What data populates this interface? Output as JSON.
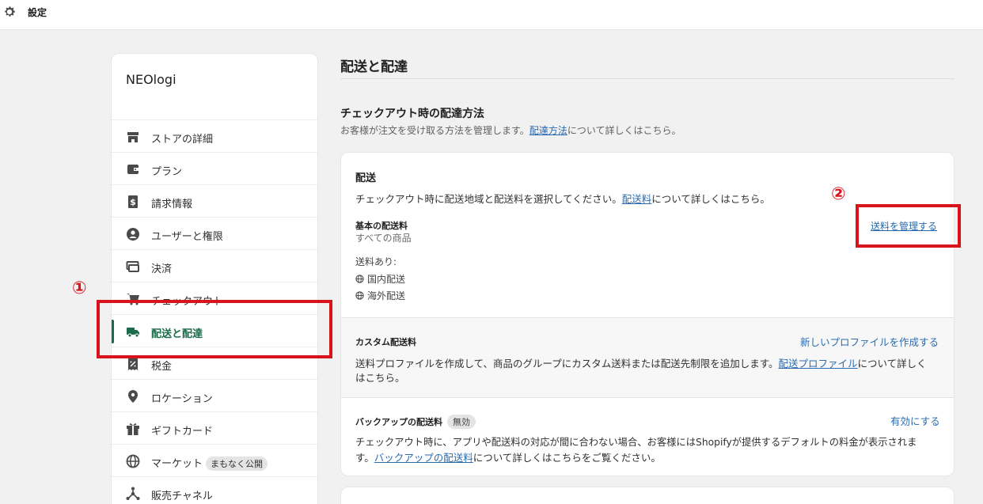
{
  "topbar": {
    "title": "設定",
    "icon": "gear-icon"
  },
  "sidebar": {
    "store_name": "NEOlogi",
    "items": [
      {
        "label": "ストアの詳細",
        "icon": "store-icon"
      },
      {
        "label": "プラン",
        "icon": "wallet-icon"
      },
      {
        "label": "請求情報",
        "icon": "dollar-icon"
      },
      {
        "label": "ユーザーと権限",
        "icon": "user-icon"
      },
      {
        "label": "決済",
        "icon": "payment-icon"
      },
      {
        "label": "チェックアウト",
        "icon": "cart-icon"
      },
      {
        "label": "配送と配達",
        "icon": "truck-icon",
        "active": true
      },
      {
        "label": "税金",
        "icon": "receipt-icon"
      },
      {
        "label": "ロケーション",
        "icon": "location-icon"
      },
      {
        "label": "ギフトカード",
        "icon": "gift-icon"
      },
      {
        "label": "マーケット",
        "icon": "globe-icon",
        "badge": "まもなく公開"
      },
      {
        "label": "販売チャネル",
        "icon": "channels-icon"
      }
    ]
  },
  "main": {
    "title": "配送と配達",
    "section_title": "チェックアウト時の配達方法",
    "section_desc_pre": "お客様が注文を受け取る方法を管理します。",
    "section_desc_link": "配達方法",
    "section_desc_post": "について詳しくはこちら。",
    "shipping": {
      "title": "配送",
      "desc_pre": "チェックアウト時に配送地域と配送料を選択してください。",
      "desc_link": "配送料",
      "desc_post": "について詳しくはこちら。",
      "base_rate_title": "基本の配送料",
      "base_rate_sub": "すべての商品",
      "manage_link": "送料を管理する",
      "rates_label": "送料あり:",
      "zones": [
        "国内配送",
        "海外配送"
      ]
    },
    "custom": {
      "title": "カスタム配送料",
      "action": "新しいプロファイルを作成する",
      "desc_pre": "送料プロファイルを作成して、商品のグループにカスタム送料または配送先制限を追加します。",
      "desc_link": "配送プロファイル",
      "desc_post": "について詳しく",
      "desc_line2": "はこちら。"
    },
    "backup": {
      "title": "バックアップの配送料",
      "badge": "無効",
      "action": "有効にする",
      "desc_line1": "チェックアウト時に、アプリや配送料の対応が間に合わない場合、お客様にはShopifyが提供するデフォルトの料金が表示されま",
      "desc_line2_pre": "す。",
      "desc_link": "バックアップの配送料",
      "desc_post": "について詳しくはこちらをご覧ください。"
    }
  },
  "annotations": {
    "marker1": "①",
    "marker2": "②",
    "color": "#d8141a"
  }
}
